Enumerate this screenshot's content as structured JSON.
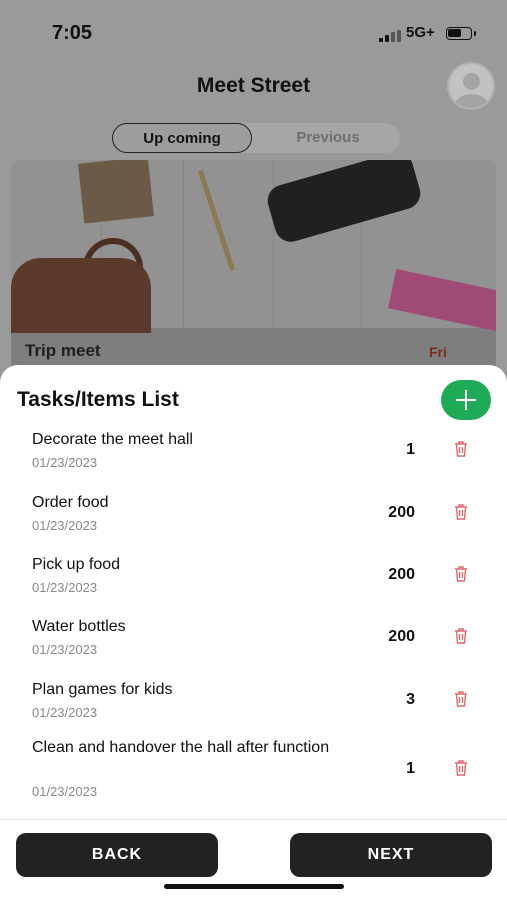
{
  "status_bar": {
    "time": "7:05",
    "network": "5G+"
  },
  "app": {
    "title": "Meet Street"
  },
  "segments": {
    "upcoming": "Up coming",
    "previous": "Previous"
  },
  "event_card": {
    "name": "Trip meet",
    "day": "Fri"
  },
  "sheet": {
    "title": "Tasks/Items List",
    "add_icon": "plus-icon",
    "tasks": [
      {
        "name": "Decorate the meet hall",
        "date": "01/23/2023",
        "qty": "1"
      },
      {
        "name": "Order food",
        "date": "01/23/2023",
        "qty": "200"
      },
      {
        "name": "Pick up food",
        "date": "01/23/2023",
        "qty": "200"
      },
      {
        "name": "Water bottles",
        "date": "01/23/2023",
        "qty": "200"
      },
      {
        "name": "Plan games for kids",
        "date": "01/23/2023",
        "qty": "3"
      },
      {
        "name": "Clean and handover the hall after function",
        "date": "01/23/2023",
        "qty": "1"
      }
    ],
    "delete_icon": "trash-icon",
    "back_label": "BACK",
    "next_label": "NEXT"
  },
  "colors": {
    "accent_green": "#1FAA58",
    "delete_red": "#E0696B",
    "button_dark": "#222222"
  }
}
